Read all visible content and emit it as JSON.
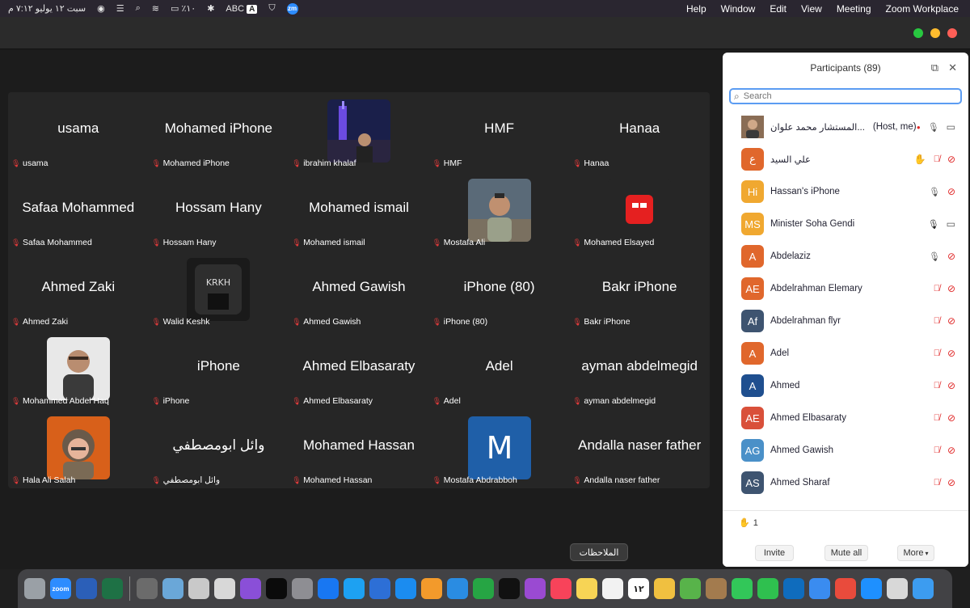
{
  "menubar": {
    "clock": "سبت ١٢ يوليو ٧:١٢ م",
    "battery": "٪١٠",
    "input_source": "ABC",
    "input_source_letter": "A",
    "zoom_status": "zm",
    "menus": [
      "Help",
      "Window",
      "Edit",
      "View",
      "Meeting",
      "Zoom Workplace"
    ]
  },
  "gallery": {
    "tiles": [
      {
        "display": "usama",
        "label": "usama",
        "photo": false
      },
      {
        "display": "Mohamed iPhone",
        "label": "Mohamed iPhone",
        "photo": false
      },
      {
        "display": "",
        "label": "ibrahim khalaf",
        "photo": true,
        "photo_kind": "night-city"
      },
      {
        "display": "HMF",
        "label": "HMF",
        "photo": false
      },
      {
        "display": "Hanaa",
        "label": "Hanaa",
        "photo": false
      },
      {
        "display": "Safaa Mohammed",
        "label": "Safaa Mohammed",
        "photo": false
      },
      {
        "display": "Hossam Hany",
        "label": "Hossam Hany",
        "photo": false
      },
      {
        "display": "Mohamed ismail",
        "label": "Mohamed ismail",
        "photo": false
      },
      {
        "display": "",
        "label": "Mostafa Ali",
        "photo": true,
        "photo_kind": "portrait-outdoor"
      },
      {
        "display": "",
        "label": "Mohamed Elsayed",
        "photo": true,
        "photo_kind": "red-logo"
      },
      {
        "display": "Ahmed Zaki",
        "label": "Ahmed Zaki",
        "photo": false
      },
      {
        "display": "",
        "label": "Walid Keshk",
        "photo": true,
        "photo_kind": "dark-logo"
      },
      {
        "display": "Ahmed Gawish",
        "label": "Ahmed Gawish",
        "photo": false
      },
      {
        "display": "iPhone (80)",
        "label": "iPhone (80)",
        "photo": false
      },
      {
        "display": "Bakr iPhone",
        "label": "Bakr iPhone",
        "photo": false
      },
      {
        "display": "",
        "label": "Mohammed Abdel Haq",
        "photo": true,
        "photo_kind": "portrait-studio"
      },
      {
        "display": "iPhone",
        "label": "iPhone",
        "photo": false
      },
      {
        "display": "Ahmed Elbasaraty",
        "label": "Ahmed Elbasaraty",
        "photo": false
      },
      {
        "display": "Adel",
        "label": "Adel",
        "photo": false
      },
      {
        "display": "ayman abdelmegid",
        "label": "ayman abdelmegid",
        "photo": false
      },
      {
        "display": "",
        "label": "Hala Ali Salah",
        "photo": true,
        "photo_kind": "portrait-orange"
      },
      {
        "display": "وائل ابومصطفي",
        "label": "وائل ابومصطفي",
        "photo": false
      },
      {
        "display": "Mohamed Hassan",
        "label": "Mohamed Hassan",
        "photo": false
      },
      {
        "display": "",
        "label": "Mostafa Abdrabboh",
        "photo": true,
        "photo_kind": "letter-m",
        "letter": "M"
      },
      {
        "display": "Andalla naser father",
        "label": "Andalla naser father",
        "photo": false
      }
    ]
  },
  "panel": {
    "title": "Participants (89)",
    "search_placeholder": "Search",
    "participants": [
      {
        "name": "المستشار محمد علوان...",
        "tag": "(Host, me)",
        "initials": "",
        "color": "#8a6d55",
        "photo": true,
        "mic": "on",
        "cam": "on",
        "rec": true,
        "hand": false
      },
      {
        "name": "علي السيد",
        "tag": "",
        "initials": "ع",
        "color": "#e0672c",
        "photo": false,
        "mic": "off",
        "cam": "off",
        "rec": false,
        "hand": true
      },
      {
        "name": "Hassan's iPhone",
        "tag": "",
        "initials": "Hi",
        "color": "#f0a830",
        "photo": false,
        "mic": "on",
        "cam": "off",
        "rec": false,
        "hand": false
      },
      {
        "name": "Minister Soha Gendi",
        "tag": "",
        "initials": "MS",
        "color": "#f0a830",
        "photo": false,
        "mic": "on-dark",
        "cam": "on",
        "rec": false,
        "hand": false
      },
      {
        "name": "Abdelaziz",
        "tag": "",
        "initials": "A",
        "color": "#e0672c",
        "photo": false,
        "mic": "on",
        "cam": "off",
        "rec": false,
        "hand": false
      },
      {
        "name": "Abdelrahman Elemary",
        "tag": "",
        "initials": "AE",
        "color": "#e0672c",
        "photo": false,
        "mic": "off",
        "cam": "off",
        "rec": false,
        "hand": false
      },
      {
        "name": "Abdelrahman flyr",
        "tag": "",
        "initials": "Af",
        "color": "#3e5470",
        "photo": false,
        "mic": "off",
        "cam": "off",
        "rec": false,
        "hand": false
      },
      {
        "name": "Adel",
        "tag": "",
        "initials": "A",
        "color": "#e0672c",
        "photo": false,
        "mic": "off",
        "cam": "off",
        "rec": false,
        "hand": false
      },
      {
        "name": "Ahmed",
        "tag": "",
        "initials": "A",
        "color": "#1f4f8f",
        "photo": false,
        "mic": "off",
        "cam": "off",
        "rec": false,
        "hand": false
      },
      {
        "name": "Ahmed Elbasaraty",
        "tag": "",
        "initials": "AE",
        "color": "#d9503a",
        "photo": false,
        "mic": "off",
        "cam": "off",
        "rec": false,
        "hand": false
      },
      {
        "name": "Ahmed Gawish",
        "tag": "",
        "initials": "AG",
        "color": "#4a90c8",
        "photo": false,
        "mic": "off",
        "cam": "off",
        "rec": false,
        "hand": false
      },
      {
        "name": "Ahmed Sharaf",
        "tag": "",
        "initials": "AS",
        "color": "#3e5470",
        "photo": false,
        "mic": "off",
        "cam": "off",
        "rec": false,
        "hand": false
      }
    ],
    "raised_hands_count": "1",
    "invite_label": "Invite",
    "mute_all_label": "Mute all",
    "more_label": "More"
  },
  "tooltip": "الملاحظات",
  "dock": {
    "zoom_label": "zoom",
    "calendar_day": "١٢",
    "apps": [
      "trash",
      "zoom",
      "word",
      "excel",
      "sysprefs",
      "preview",
      "spray",
      "printer",
      "siri",
      "activity",
      "whatsapp",
      "messenger",
      "twitter",
      "defender",
      "appstore",
      "pages",
      "keynote",
      "numbers",
      "tv",
      "podcasts",
      "music",
      "notes",
      "reminders",
      "calendar",
      "photos",
      "maps",
      "contacts",
      "messages",
      "facetime",
      "outlook",
      "mail",
      "chrome",
      "safari",
      "launchpad",
      "finder"
    ],
    "colors": {
      "trash": "#9aa0a6",
      "zoom": "#2d8cff",
      "word": "#2b5fb8",
      "excel": "#1e7145",
      "sysprefs": "#6b6b6b",
      "preview": "#6aa7d8",
      "spray": "#c9c9c9",
      "printer": "#d8d8d8",
      "siri": "#8a4fd8",
      "activity": "#0b0b0b",
      "whatsapp": "#8e8e93",
      "messenger": "#1877f2",
      "twitter": "#1da1f2",
      "defender": "#2d6fd6",
      "appstore": "#1b8cf0",
      "pages": "#f39a2b",
      "keynote": "#2a8ce2",
      "numbers": "#26a544",
      "tv": "#111111",
      "podcasts": "#9a4ad2",
      "music": "#f8435a",
      "notes": "#f7d455",
      "reminders": "#f2f2f2",
      "calendar": "#ffffff",
      "photos": "#f0c040",
      "maps": "#58b34a",
      "contacts": "#a37b4e",
      "messages": "#32c759",
      "facetime": "#2fc04f",
      "outlook": "#0f6cbd",
      "mail": "#3a8cf0",
      "chrome": "#e94b3c",
      "safari": "#1e90ff",
      "launchpad": "#d8d8d8",
      "finder": "#3c9cf0"
    }
  }
}
